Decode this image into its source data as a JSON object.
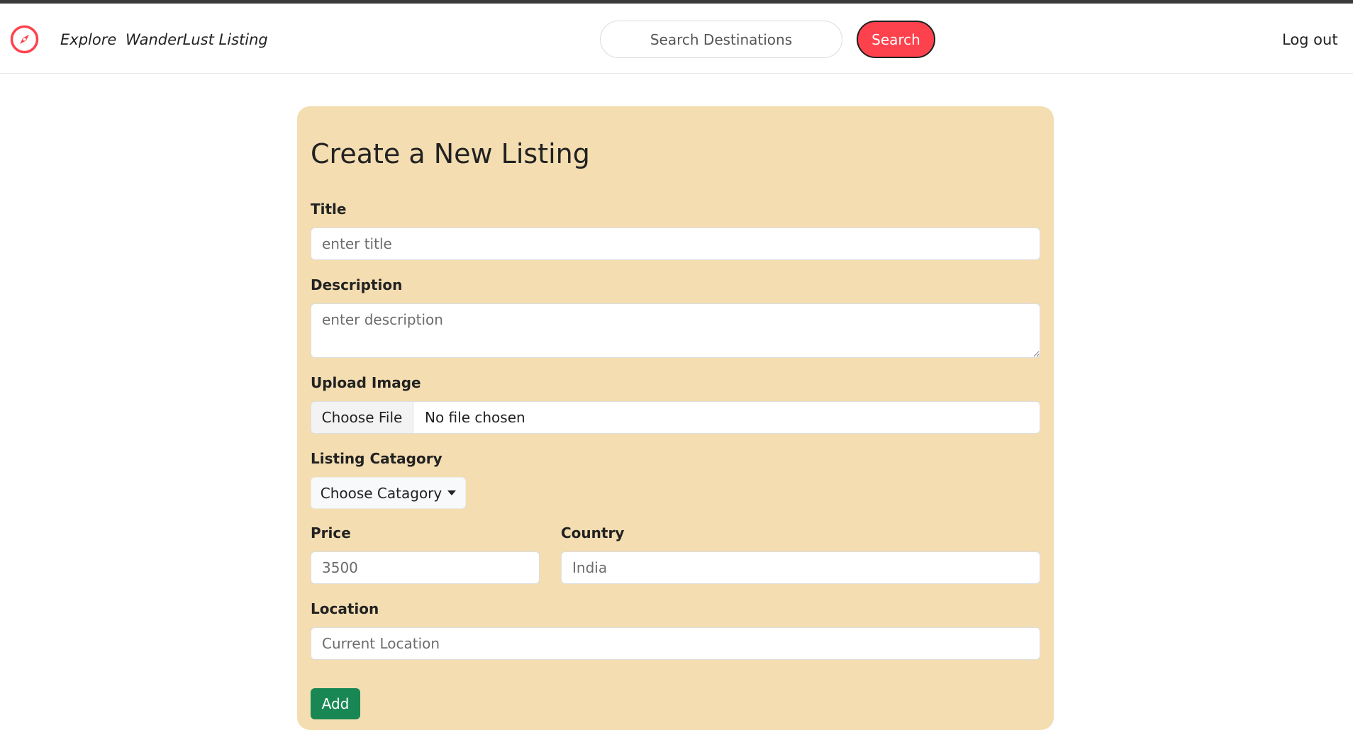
{
  "navbar": {
    "brand_icon": "compass-icon",
    "brand_color": "#fe424d",
    "explore_label": "Explore",
    "listing_label": "WanderLust Listing",
    "search_placeholder": "Search Destinations",
    "search_button_label": "Search",
    "logout_label": "Log out"
  },
  "form": {
    "heading": "Create a New Listing",
    "title_label": "Title",
    "title_placeholder": "enter title",
    "description_label": "Description",
    "description_placeholder": "enter description",
    "image_label": "Upload Image",
    "file_button_label": "Choose File",
    "file_status": "No file chosen",
    "category_label": "Listing Catagory",
    "category_button_label": "Choose Catagory",
    "price_label": "Price",
    "price_placeholder": "3500",
    "country_label": "Country",
    "country_placeholder": "India",
    "location_label": "Location",
    "location_placeholder": "Current Location",
    "submit_label": "Add"
  },
  "colors": {
    "accent": "#fe424d",
    "card_background": "#f3ddb1",
    "submit_button": "#198754"
  }
}
